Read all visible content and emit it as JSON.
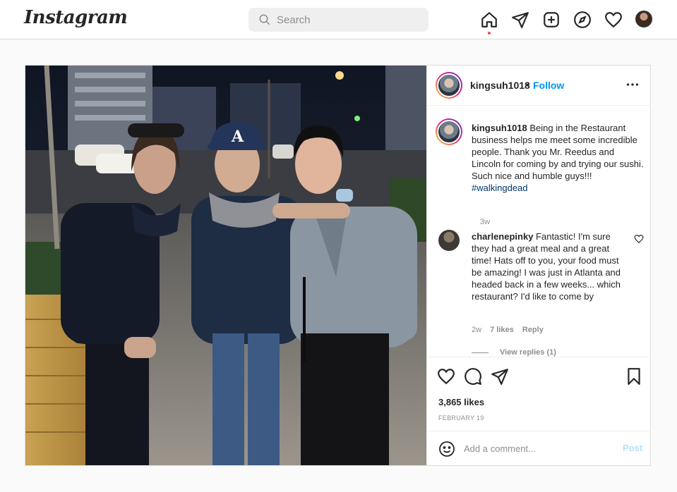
{
  "nav": {
    "logo": "Instagram",
    "search_placeholder": "Search",
    "icons": [
      "home-icon",
      "direct-icon",
      "new-post-icon",
      "explore-icon",
      "activity-icon",
      "profile-avatar"
    ]
  },
  "post": {
    "username": "kingsuh1018",
    "follow_label": "Follow",
    "separator": "•",
    "caption": {
      "username": "kingsuh1018",
      "text": " Being in the Restaurant business helps me meet some incredible people. Thank you Mr. Reedus and Lincoln for coming by and trying our sushi. Such nice and humble guys!!! ",
      "hashtag": "#walkingdead",
      "time": "3w"
    },
    "comments": [
      {
        "username": "charlenepinky",
        "text": " Fantastic! I'm sure they had a great meal and a great time! Hats off to you, your food must be amazing! I was just in Atlanta and headed back in a few weeks... which restaurant? I'd like to come by",
        "time": "2w",
        "likes": "7 likes",
        "reply_label": "Reply",
        "view_replies": "View replies (1)"
      }
    ],
    "likes": "3,865 likes",
    "date": "FEBRUARY 19",
    "add_comment_placeholder": "Add a comment...",
    "post_button": "Post"
  },
  "colors": {
    "link_blue": "#0095f6",
    "post_disabled": "#b2dffc",
    "notification_dot": "#ed4956",
    "hashtag": "#00376b"
  }
}
